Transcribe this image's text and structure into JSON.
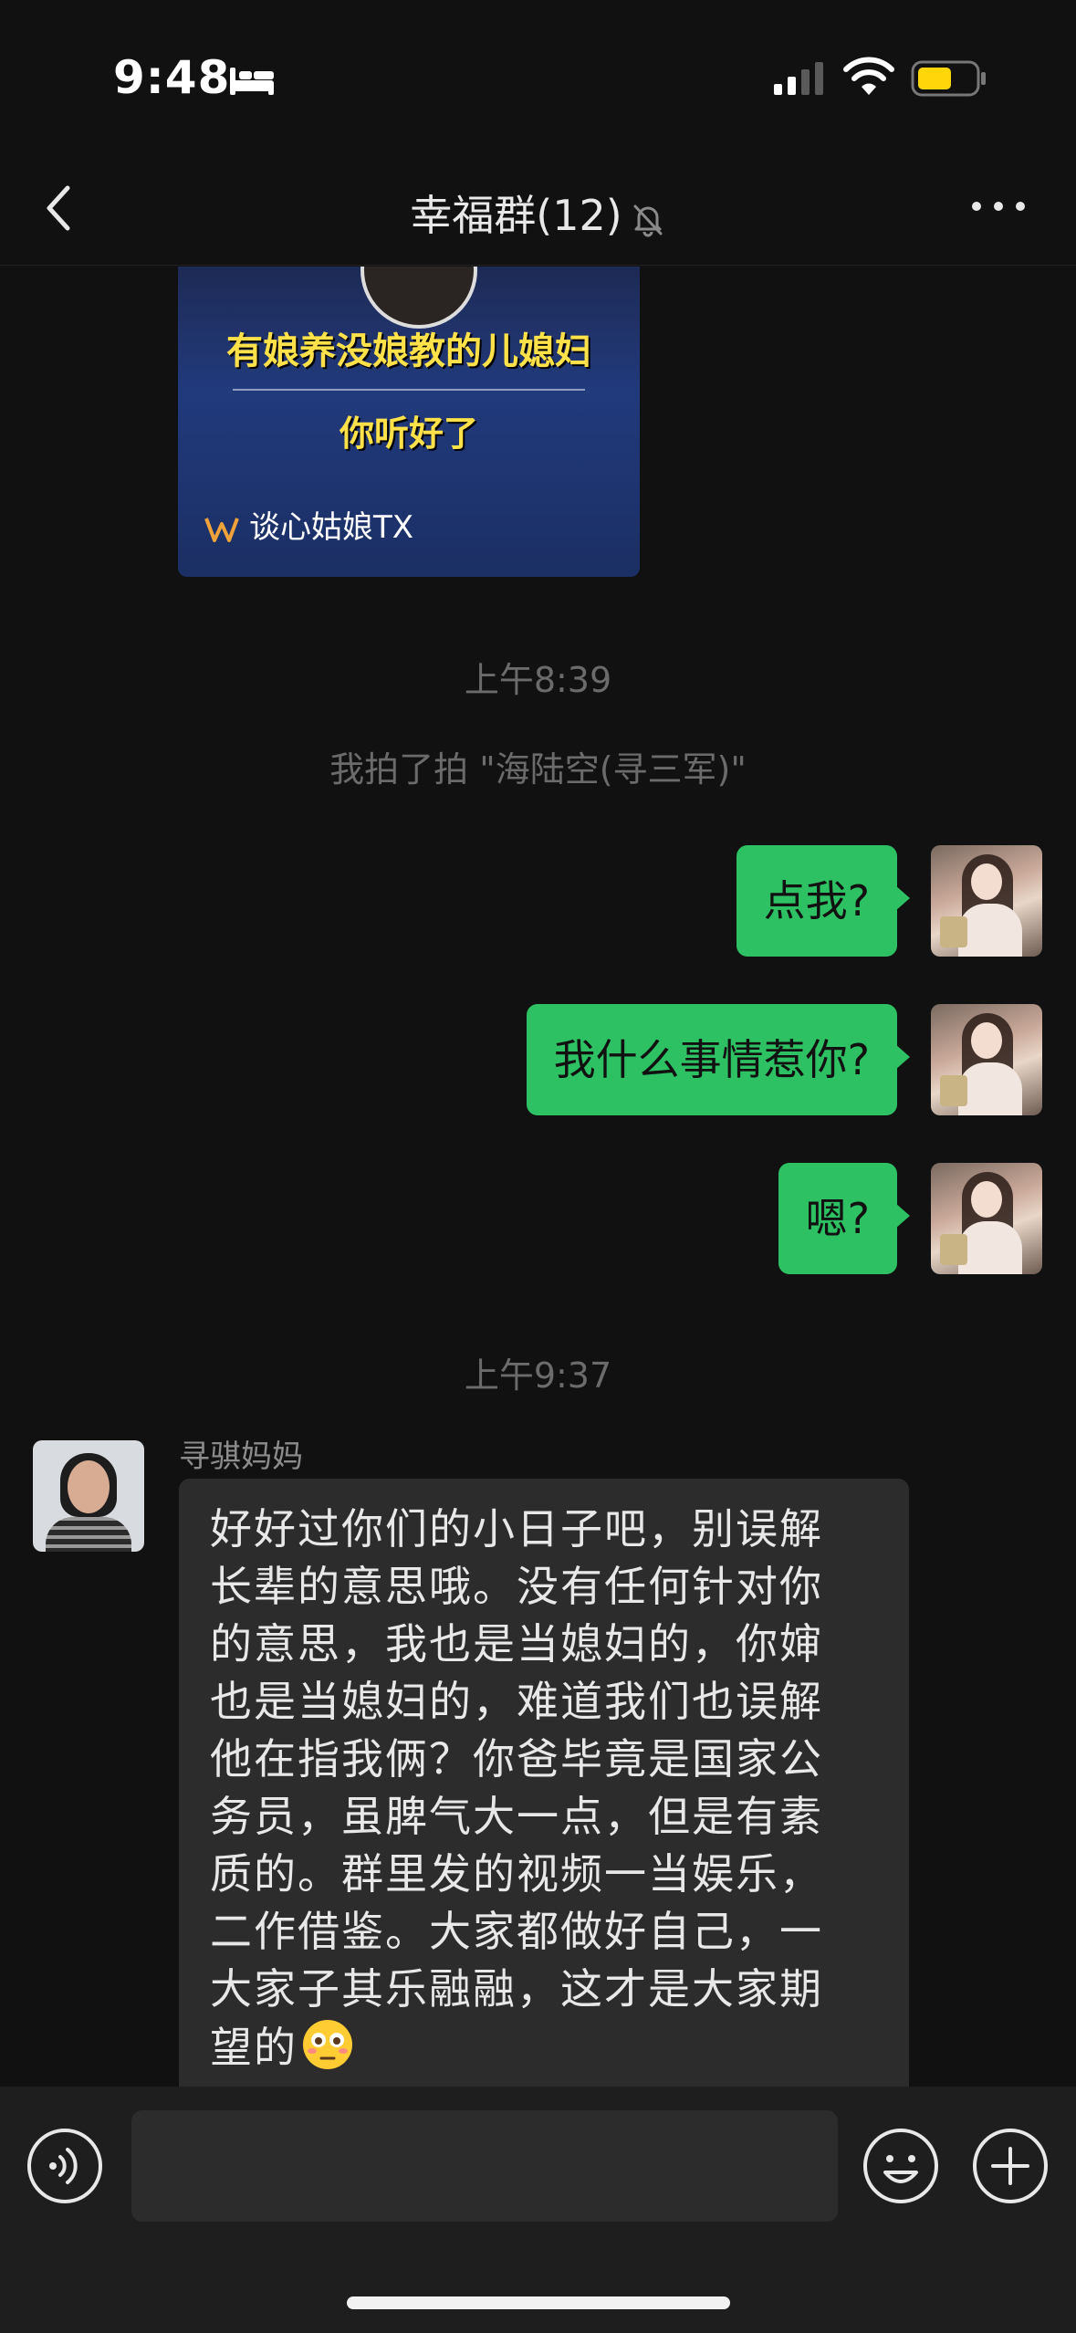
{
  "status_bar": {
    "time": "9:48",
    "icons": [
      "bed-icon",
      "signal-icon",
      "wifi-icon",
      "battery-icon"
    ],
    "battery_color": "#ffd60a"
  },
  "nav": {
    "title": "幸福群(12)",
    "icons": [
      "back-icon",
      "mute-bell-icon",
      "more-icon"
    ]
  },
  "video_card": {
    "line1": "有娘养没娘教的儿媳妇",
    "line2": "你听好了",
    "source": "谈心姑娘TX",
    "text_color": "#ffe14a"
  },
  "messages": {
    "time1": "上午8:39",
    "pat": "我拍了拍 \"海陆空(寻三军)\"",
    "outgoing": [
      "点我?",
      "我什么事情惹你?",
      "嗯?"
    ],
    "time2": "上午9:37",
    "incoming": {
      "sender": "寻骐妈妈",
      "lines": [
        "好好过你们的小日子吧，别误解",
        "长辈的意思哦。没有任何针对你",
        "的意思，我也是当媳妇的，你婶",
        "也是当媳妇的，难道我们也误解",
        "他在指我俩？你爸毕竟是国家公",
        "务员，虽脾气大一点，但是有素",
        "质的。群里发的视频一当娱乐，",
        "二作借鉴。大家都做好自己，一",
        "大家子其乐融融，这才是大家期",
        "望的"
      ],
      "emoji": "flushed-face-emoji"
    }
  },
  "input_bar": {
    "input_value": "",
    "icons": [
      "voice-icon",
      "emoji-icon",
      "plus-icon"
    ]
  },
  "colors": {
    "background": "#111111",
    "outgoing_bubble": "#2dc163",
    "incoming_bubble": "#2c2c2c"
  }
}
